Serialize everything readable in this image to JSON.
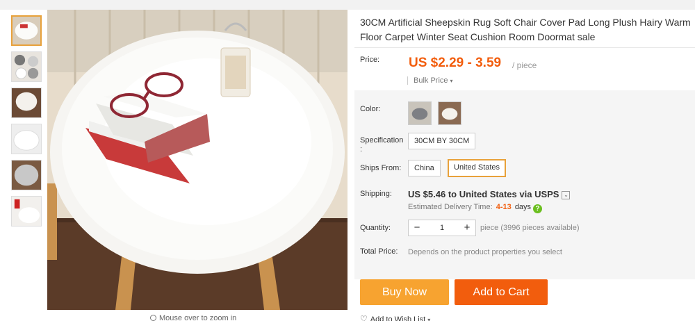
{
  "product": {
    "title": "30CM Artificial Sheepskin Rug Soft Chair Cover Pad Long Plush Hairy Warm Floor Carpet Winter Seat Cushion Room Doormat sale"
  },
  "gallery": {
    "zoom_hint": "Mouse over to zoom in",
    "thumbnail_count": 6
  },
  "price": {
    "label": "Price:",
    "value": "US $2.29 - 3.59",
    "unit": "/ piece",
    "bulk_label": "Bulk Price",
    "bulk_caret": "▾"
  },
  "color": {
    "label": "Color:"
  },
  "specification": {
    "label": "Specification :",
    "option": "30CM BY 30CM"
  },
  "ships_from": {
    "label": "Ships From:",
    "options": [
      "China",
      "United States"
    ],
    "selected": "United States"
  },
  "shipping": {
    "label": "Shipping:",
    "main": "US $5.46 to United States via USPS",
    "dropdown_glyph": "⌄",
    "est_label": "Estimated Delivery Time:",
    "days_value": "4-13",
    "days_unit": "days",
    "help_glyph": "?"
  },
  "quantity": {
    "label": "Quantity:",
    "minus": "−",
    "plus": "+",
    "value": "1",
    "available": "piece (3996 pieces available)"
  },
  "total": {
    "label": "Total Price:",
    "text": "Depends on the product properties you select"
  },
  "actions": {
    "buy_now": "Buy Now",
    "add_to_cart": "Add to Cart",
    "wish_list": "Add to Wish List",
    "wish_caret": "▾"
  },
  "colors": {
    "price_orange": "#f25d0d",
    "buy_now": "#f7a330",
    "add_to_cart": "#f25d0d",
    "selected_border": "#e8a13a"
  }
}
